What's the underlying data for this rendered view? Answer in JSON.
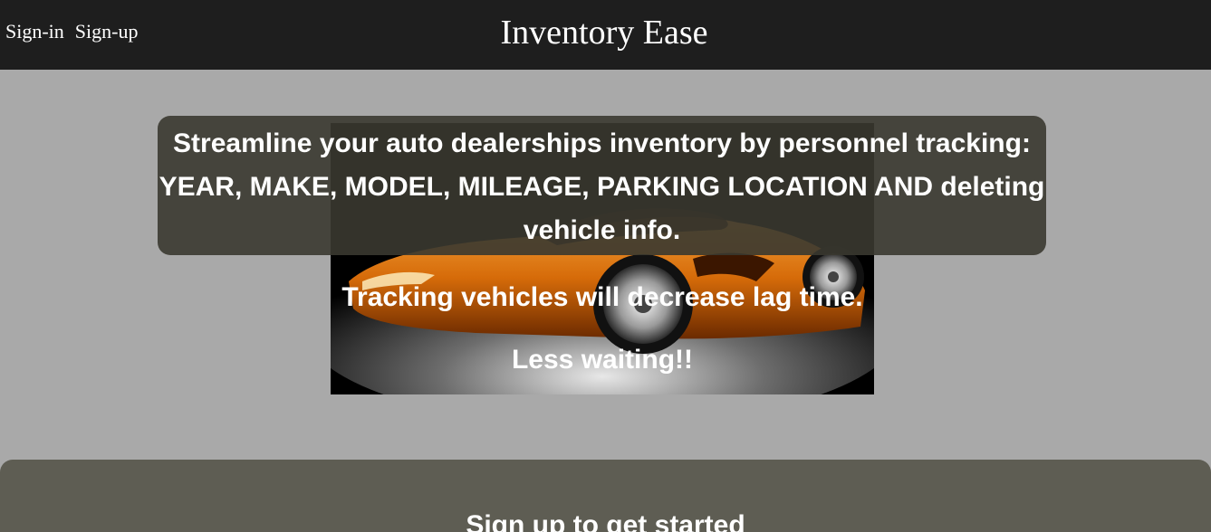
{
  "header": {
    "nav": [
      "Sign-in",
      "Sign-up"
    ],
    "title": "Inventory Ease"
  },
  "hero": {
    "image": "orange sports car on black background",
    "headline": "Streamline your auto dealerships inventory by personnel tracking: YEAR, MAKE, MODEL, MILEAGE, PARKING LOCATION AND deleting vehicle info.",
    "line2": "Tracking vehicles will decrease lag time.",
    "line3": "Less waiting!!"
  },
  "bottom": {
    "partial_text": "Sign up to get started"
  },
  "colors": {
    "header_bg": "#1e1e1e",
    "page_bg": "#a9a9a9",
    "panel_bg": "#3a3930",
    "bottom_bg": "#5e5d53",
    "car_orange": "#d9740b"
  }
}
